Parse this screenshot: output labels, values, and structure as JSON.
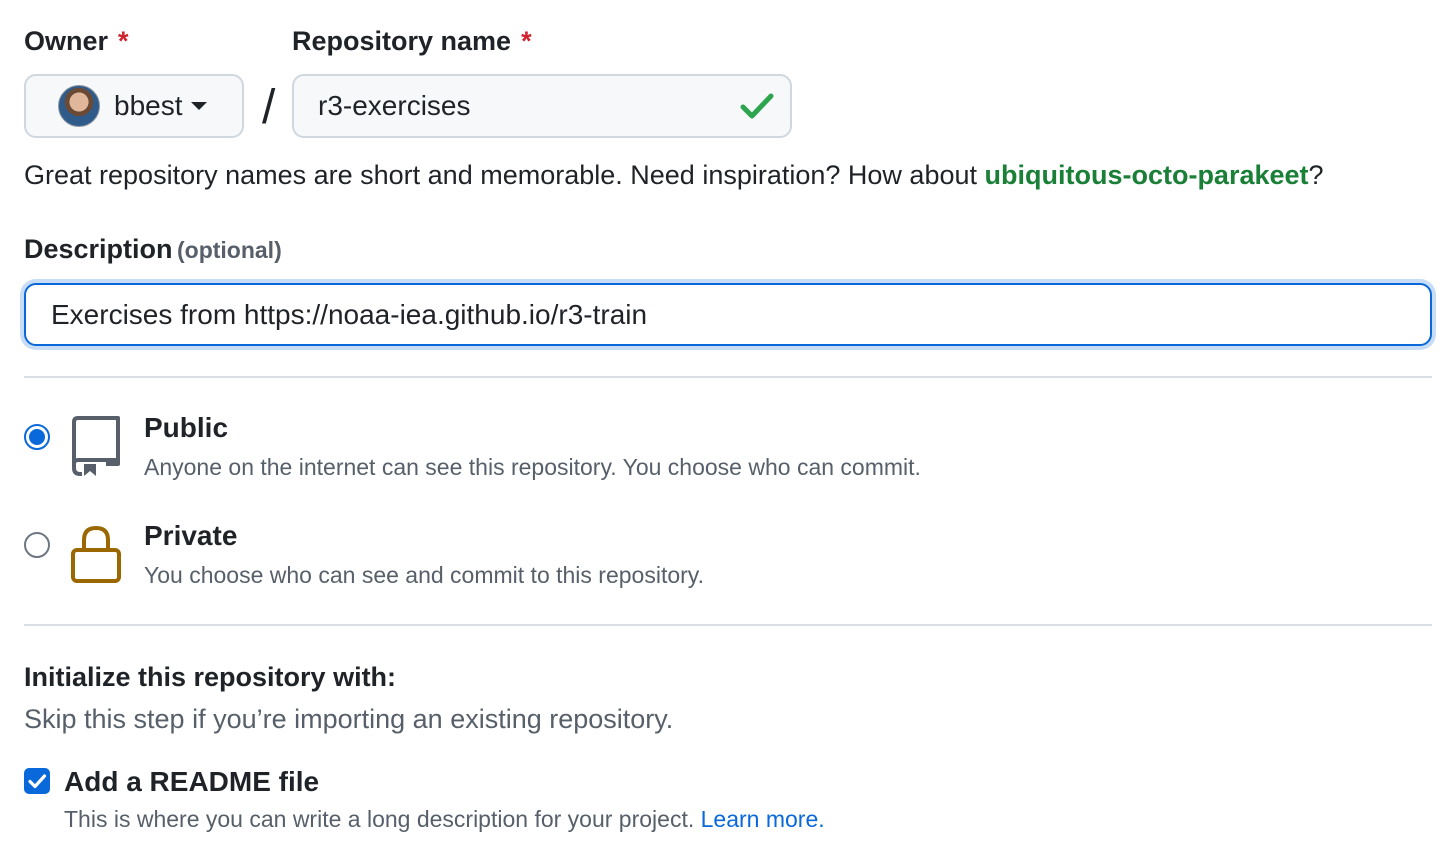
{
  "owner": {
    "label": "Owner",
    "required_mark": "*",
    "name": "bbest"
  },
  "repo": {
    "label": "Repository name",
    "required_mark": "*",
    "value": "r3-exercises",
    "separator": "/"
  },
  "hint": {
    "text": "Great repository names are short and memorable. Need inspiration? How about ",
    "suggestion": "ubiquitous-octo-parakeet",
    "suffix": "?"
  },
  "description": {
    "label": "Description",
    "optional": "(optional)",
    "value": "Exercises from https://noaa-iea.github.io/r3-train"
  },
  "visibility": {
    "selected": "public",
    "public_title": "Public",
    "public_desc": "Anyone on the internet can see this repository. You choose who can commit.",
    "private_title": "Private",
    "private_desc": "You choose who can see and commit to this repository."
  },
  "init": {
    "title": "Initialize this repository with:",
    "subtitle": "Skip this step if you’re importing an existing repository.",
    "readme_label": "Add a README file",
    "readme_checked": true,
    "readme_desc": "This is where you can write a long description for your project.",
    "learn_more": "Learn more."
  },
  "colors": {
    "accent": "#0969da",
    "success": "#1a7f37",
    "required": "#cf222e",
    "lock": "#9a6700"
  }
}
